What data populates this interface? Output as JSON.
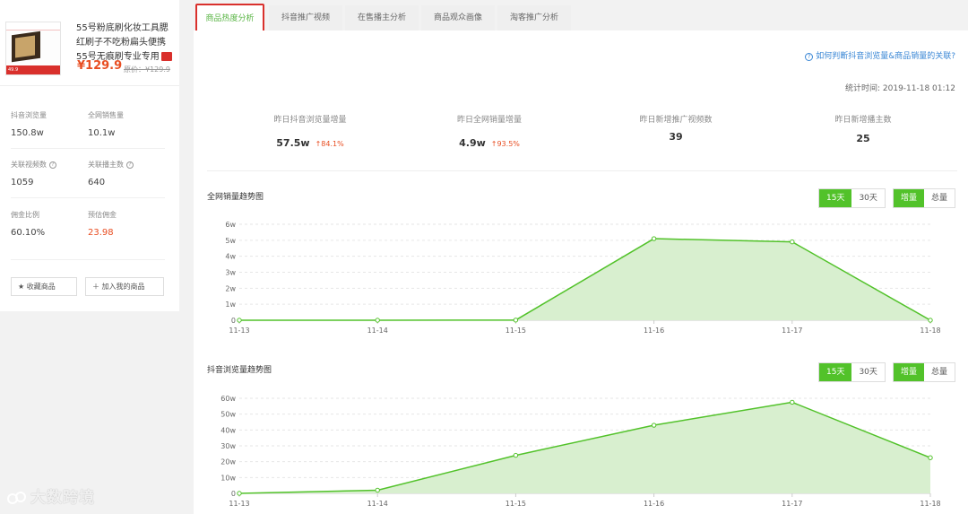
{
  "product": {
    "title": "55号粉底刷化妆工具腮红刷子不吃粉扁头便携55号无痕刷专业专用",
    "price": "¥129.9",
    "orig_price": "原价：¥129.9",
    "thumb_header": "",
    "thumb_price": "49.9"
  },
  "stats": [
    {
      "label": "抖音浏览量",
      "value": "150.8w",
      "help": false
    },
    {
      "label": "全网销售量",
      "value": "10.1w",
      "help": false
    },
    {
      "label": "关联视频数",
      "value": "1059",
      "help": true
    },
    {
      "label": "关联播主数",
      "value": "640",
      "help": true
    },
    {
      "label": "佣金比例",
      "value": "60.10%",
      "help": false
    },
    {
      "label": "预估佣金",
      "value": "23.98",
      "help": false
    }
  ],
  "buttons": {
    "favorite": "收藏商品",
    "add": "加入我的商品"
  },
  "tabs": [
    {
      "label": "商品热度分析",
      "active": true
    },
    {
      "label": "抖音推广视频",
      "active": false
    },
    {
      "label": "在售播主分析",
      "active": false
    },
    {
      "label": "商品观众画像",
      "active": false
    },
    {
      "label": "淘客推广分析",
      "active": false
    }
  ],
  "help_link": "如何判断抖音浏览量&商品销量的关联?",
  "stat_time": "统计时间:  2019-11-18 01:12",
  "kpis": [
    {
      "label": "昨日抖音浏览量增量",
      "value": "57.5w",
      "change": "↑84.1%"
    },
    {
      "label": "昨日全网销量增量",
      "value": "4.9w",
      "change": "↑93.5%"
    },
    {
      "label": "昨日新增推广视频数",
      "value": "39",
      "change": ""
    },
    {
      "label": "昨日新增播主数",
      "value": "25",
      "change": ""
    }
  ],
  "controls": {
    "days15": "15天",
    "days30": "30天",
    "inc": "增量",
    "total": "总量"
  },
  "colors": {
    "accent": "#52c22a",
    "price": "#e84e22",
    "link": "#3a87d5",
    "area_fill": "#d8efcf"
  },
  "chart_data": [
    {
      "type": "area",
      "title": "全网销量趋势图",
      "x": [
        "11-13",
        "11-14",
        "11-15",
        "11-16",
        "11-17",
        "11-18"
      ],
      "y_ticks": [
        "0",
        "1w",
        "2w",
        "3w",
        "4w",
        "5w",
        "6w"
      ],
      "ylim": [
        0,
        60000
      ],
      "series": [
        {
          "values": [
            0,
            0,
            100,
            51000,
            49000,
            0
          ]
        }
      ],
      "grid": true
    },
    {
      "type": "area",
      "title": "抖音浏览量趋势图",
      "x": [
        "11-13",
        "11-14",
        "11-15",
        "11-16",
        "11-17",
        "11-18"
      ],
      "y_ticks": [
        "0",
        "10w",
        "20w",
        "30w",
        "40w",
        "50w",
        "60w"
      ],
      "ylim": [
        0,
        600000
      ],
      "series": [
        {
          "values": [
            0,
            20000,
            240000,
            430000,
            575000,
            225000
          ]
        }
      ],
      "grid": true
    }
  ],
  "watermark": "大数跨境"
}
